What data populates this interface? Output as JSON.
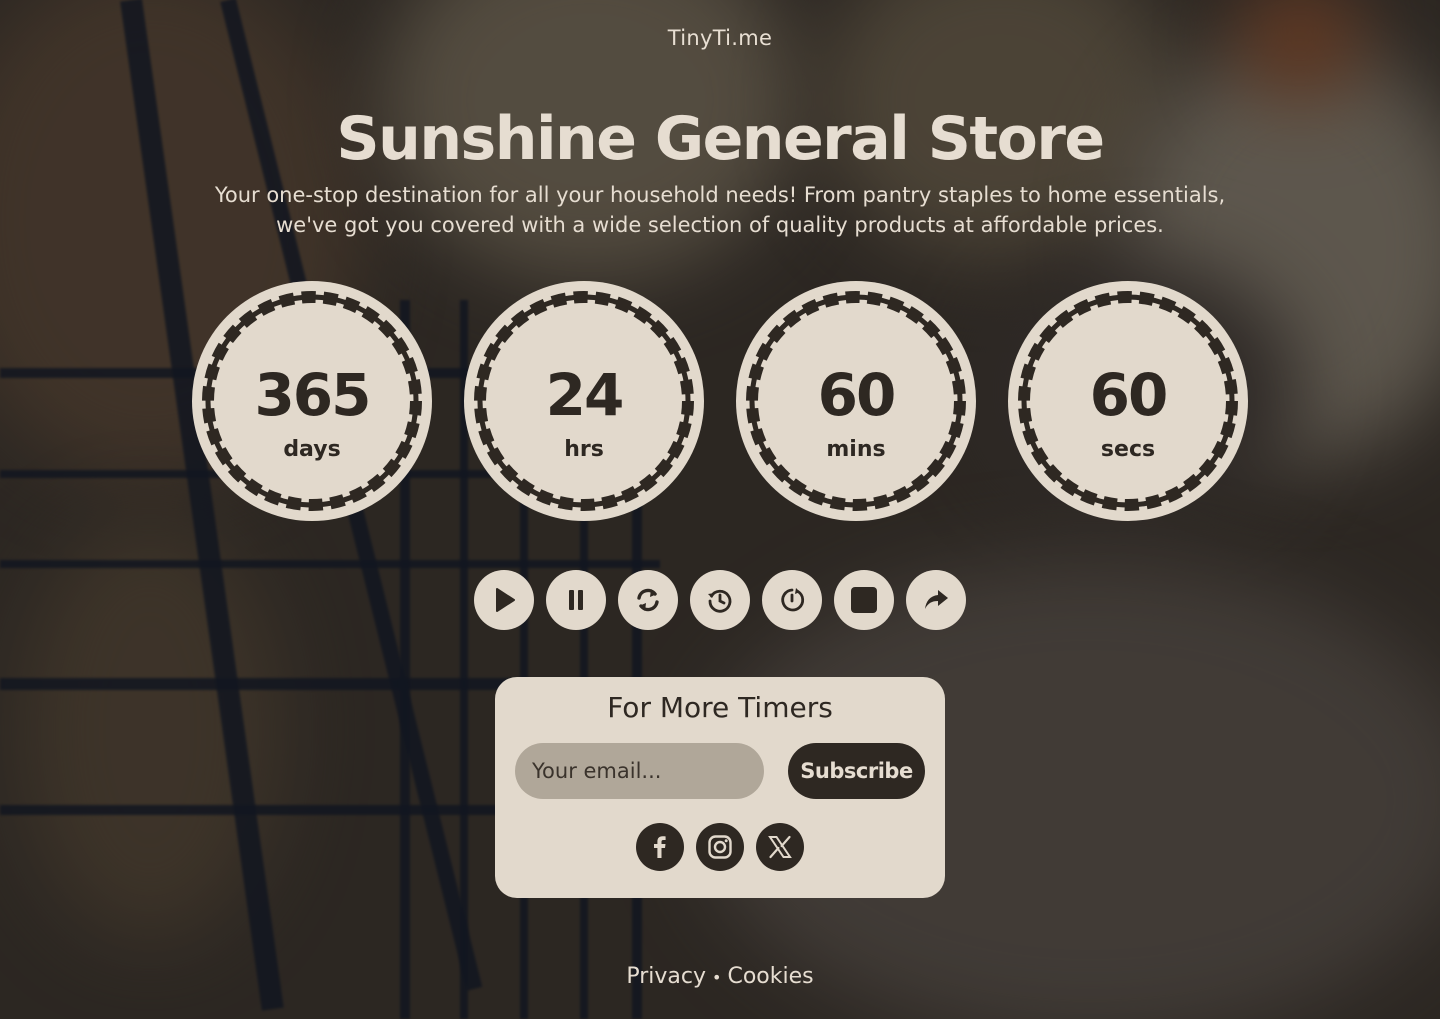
{
  "brand": "TinyTi.me",
  "title": "Sunshine General Store",
  "subtitle": "Your one-stop destination for all your household needs! From pantry staples to home essentials, we've got you covered with a wide selection of quality products at affordable prices.",
  "timers": [
    {
      "value": "365",
      "unit": "days"
    },
    {
      "value": "24",
      "unit": "hrs"
    },
    {
      "value": "60",
      "unit": "mins"
    },
    {
      "value": "60",
      "unit": "secs"
    }
  ],
  "controls": [
    "play-icon",
    "pause-icon",
    "refresh-icon",
    "history-icon",
    "timer-icon",
    "stop-icon",
    "share-icon"
  ],
  "subscribe_card": {
    "title": "For More Timers",
    "email_placeholder": "Your email...",
    "button_label": "Subscribe",
    "socials": [
      "facebook-icon",
      "instagram-icon",
      "x-icon"
    ]
  },
  "footer": {
    "privacy": "Privacy",
    "separator": "•",
    "cookies": "Cookies"
  },
  "colors": {
    "dark": "#2e2822",
    "light": "#e2d9cc",
    "input": "#b0a799"
  }
}
